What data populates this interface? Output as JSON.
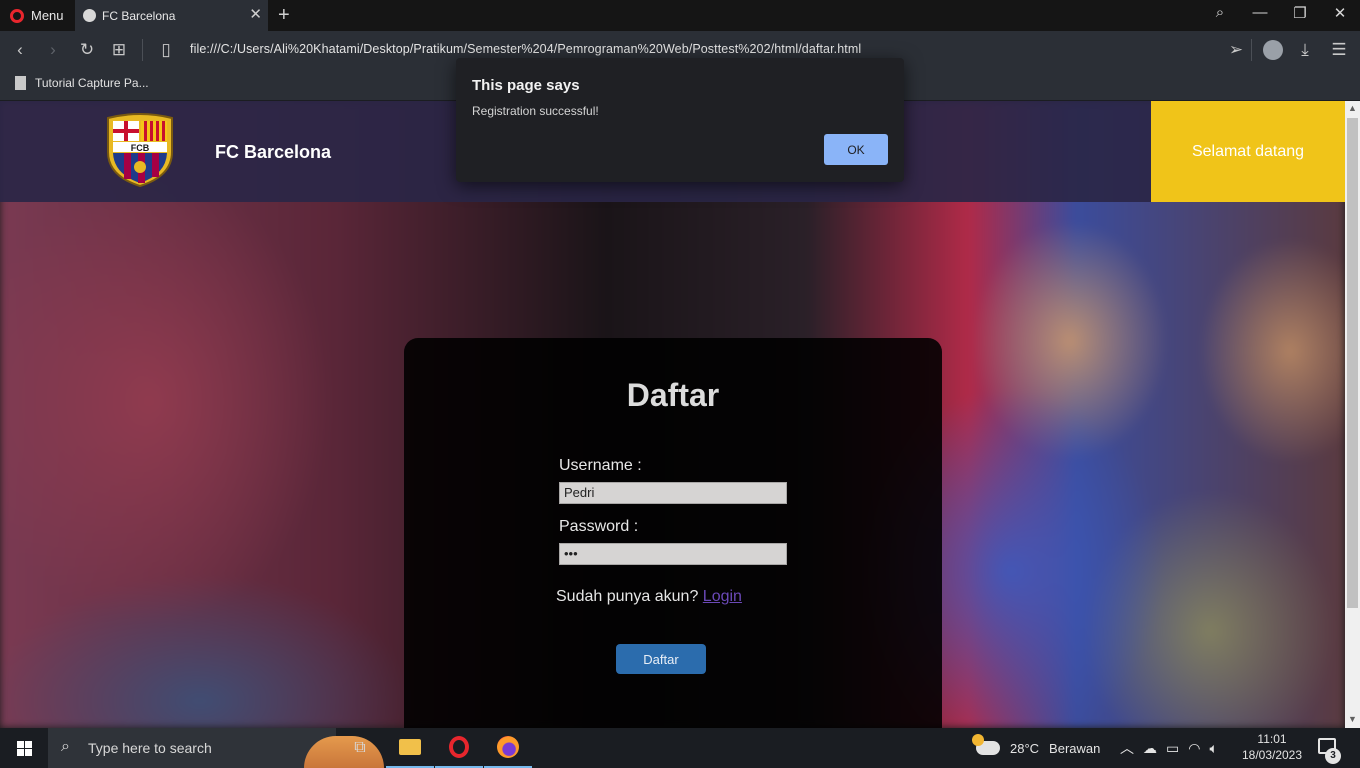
{
  "browser": {
    "menu_label": "Menu",
    "tab_title": "FC Barcelona",
    "url": "file:///C:/Users/Ali%20Khatami/Desktop/Pratikum/Semester%204/Pemrograman%20Web/Posttest%202/html/daftar.html",
    "bookmark_label": "Tutorial Capture Pa..."
  },
  "site": {
    "brand": "FC Barcelona",
    "welcome": "Selamat datang",
    "crest_text": "FCB",
    "colors": {
      "header_bg": "#2a2646",
      "welcome_bg": "#f0c419",
      "button_bg": "#2b6cad"
    }
  },
  "form": {
    "title": "Daftar",
    "username_label": "Username :",
    "username_value": "Pedri",
    "password_label": "Password :",
    "password_value": "•••",
    "hint_text": "Sudah punya akun?",
    "login_link": "Login",
    "submit_label": "Daftar"
  },
  "dialog": {
    "title": "This page says",
    "message": "Registration successful!",
    "ok_label": "OK"
  },
  "taskbar": {
    "search_placeholder": "Type here to search",
    "temperature": "28°C",
    "weather": "Berawan",
    "time": "11:01",
    "date": "18/03/2023",
    "notification_count": "3"
  }
}
